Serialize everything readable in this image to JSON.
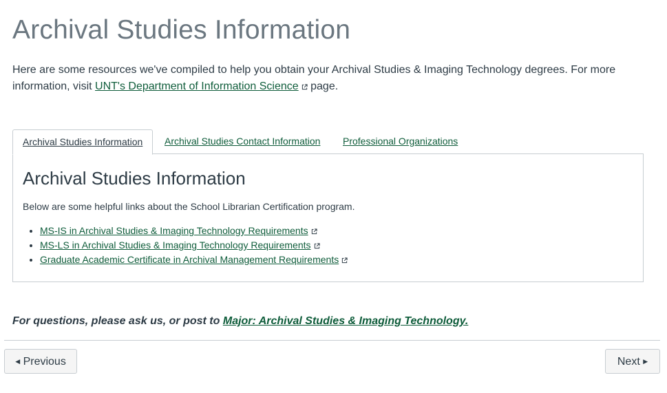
{
  "page": {
    "title": "Archival Studies Information",
    "intro_text_1": "Here are some resources we've compiled to help you obtain your Archival Studies & Imaging Technology degrees. For more information, visit",
    "intro_link": "UNT's Department of Information Science",
    "intro_text_2": "page."
  },
  "tabs": [
    {
      "label": "Archival Studies Information",
      "active": true
    },
    {
      "label": "Archival Studies Contact Information",
      "active": false
    },
    {
      "label": "Professional Organizations",
      "active": false
    }
  ],
  "panel": {
    "title": "Archival Studies Information",
    "description": "Below are some helpful links about the School Librarian Certification program.",
    "links": [
      "MS-IS in Archival Studies & Imaging Technology Requirements",
      "MS-LS in Archival Studies & Imaging Technology Requirements",
      "Graduate Academic Certificate in Archival Management Requirements"
    ]
  },
  "footer": {
    "note_text": "For questions, please ask us, or post to",
    "note_link": "Major: Archival Studies & Imaging Technology."
  },
  "navigation": {
    "previous_label": "Previous",
    "next_label": "Next",
    "previous_icon": "caret-left-icon",
    "next_icon": "caret-right-icon"
  },
  "colors": {
    "link": "#0e5c3a",
    "text": "#2d3b45",
    "title": "#6b7780",
    "border": "#c7cdd1"
  }
}
